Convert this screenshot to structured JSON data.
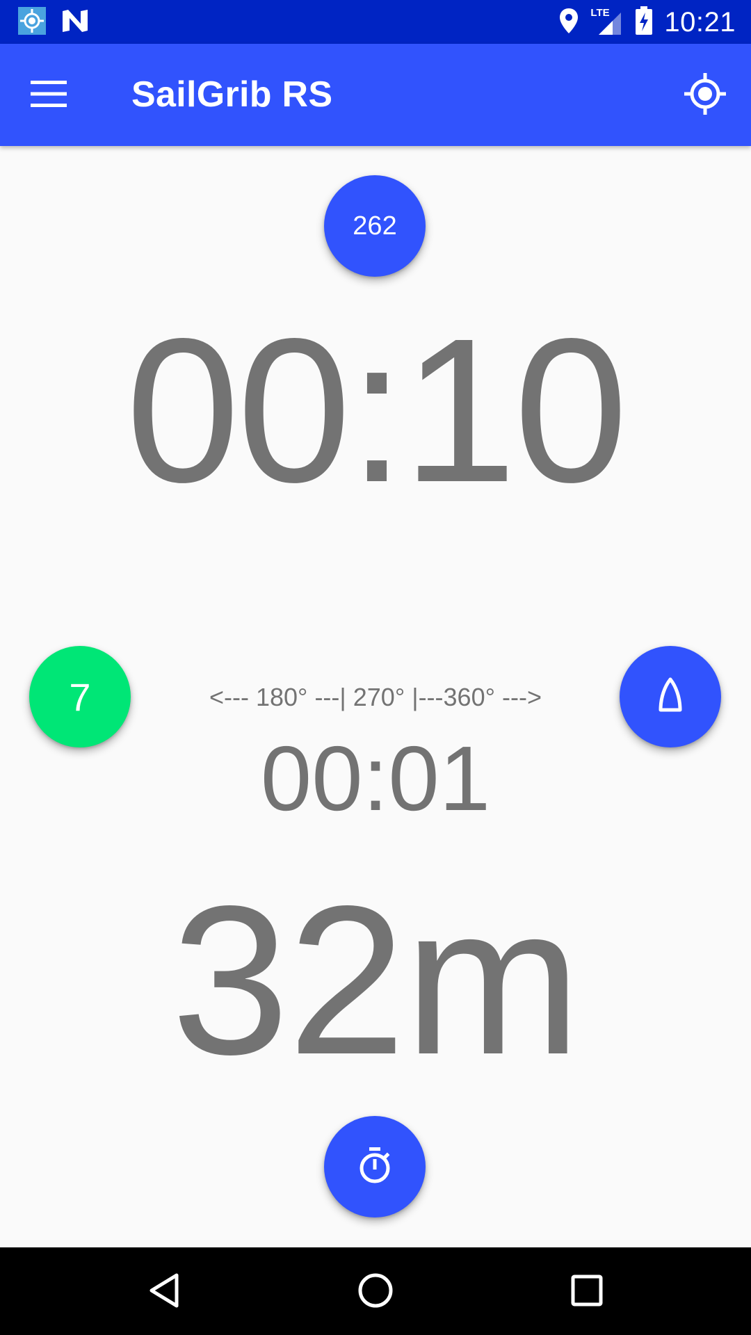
{
  "status_bar": {
    "time": "10:21",
    "network_label": "LTE",
    "icons": [
      "sailgrib-notification-icon",
      "n-notification-icon",
      "location-pin-icon",
      "lte-signal-icon",
      "battery-charging-icon"
    ]
  },
  "app_bar": {
    "title": "SailGrib RS",
    "menu_icon": "hamburger-menu-icon",
    "action_icon": "gps-locate-icon"
  },
  "heading_button": {
    "label": "262"
  },
  "main_timer": {
    "value": "00:10"
  },
  "wind_button": {
    "label": "7"
  },
  "angle_scale": {
    "text": "<--- 180° ---| 270° |---360° --->"
  },
  "secondary_timer": {
    "value": "00:01"
  },
  "distance": {
    "value": "32m"
  },
  "boat_button": {
    "icon": "boat-sail-icon"
  },
  "timer_button": {
    "icon": "stopwatch-icon"
  },
  "nav_bar": {
    "icons": [
      "back-icon",
      "home-icon",
      "recents-icon"
    ]
  },
  "colors": {
    "status_bar": "#0024c3",
    "app_bar": "#3153fd",
    "fab_blue": "#3153fd",
    "fab_green": "#00e676",
    "text_gray": "#737373",
    "background": "#fafafa"
  }
}
